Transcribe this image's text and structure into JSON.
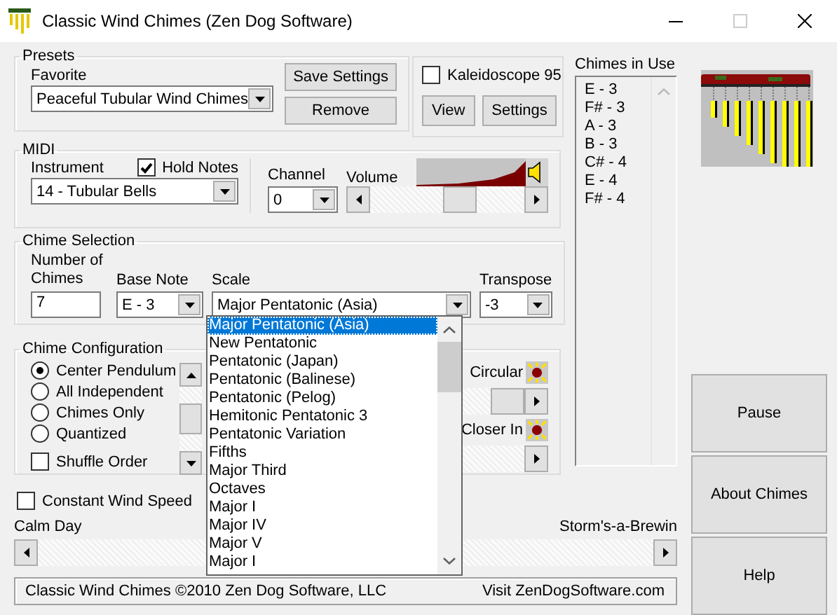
{
  "window": {
    "title": "Classic Wind Chimes (Zen Dog Software)"
  },
  "presets": {
    "title": "Presets",
    "favorite_label": "Favorite",
    "favorite": "Peaceful Tubular Wind Chimes",
    "buttons": [
      "Save Settings",
      "Remove"
    ]
  },
  "kaleidoscope": {
    "label": "Kaleidoscope 95",
    "checked": false,
    "buttons": [
      "View",
      "Settings"
    ]
  },
  "midi": {
    "title": "MIDI",
    "instrument_label": "Instrument",
    "instrument": "14 - Tubular Bells",
    "hold_notes": {
      "label": "Hold Notes",
      "checked": true
    },
    "channel_label": "Channel",
    "channel": "0",
    "volume_label": "Volume",
    "volume": {
      "level": 0.6
    }
  },
  "chime_selection": {
    "title": "Chime Selection",
    "number_label": "Number of Chimes",
    "number": "7",
    "base_note_label": "Base Note",
    "base_note": "E - 3",
    "scale_label": "Scale",
    "scale": "Major Pentatonic (Asia)",
    "transpose_label": "Transpose",
    "transpose": "-3"
  },
  "scale_dropdown": {
    "options": [
      {
        "label": "Major Pentatonic (Asia)",
        "selected": true
      },
      {
        "label": "New Pentatonic",
        "selected": false
      },
      {
        "label": "Pentatonic (Japan)",
        "selected": false
      },
      {
        "label": "Pentatonic (Balinese)",
        "selected": false
      },
      {
        "label": "Pentatonic (Pelog)",
        "selected": false
      },
      {
        "label": "Hemitonic Pentatonic 3",
        "selected": false
      },
      {
        "label": "Pentatonic Variation",
        "selected": false
      },
      {
        "label": "Fifths",
        "selected": false
      },
      {
        "label": "Major Third",
        "selected": false
      },
      {
        "label": "Octaves",
        "selected": false
      },
      {
        "label": "Major I",
        "selected": false
      },
      {
        "label": "Major IV",
        "selected": false
      },
      {
        "label": "Major V",
        "selected": false
      },
      {
        "label": "Major I",
        "selected": false
      }
    ]
  },
  "chime_configuration": {
    "title": "Chime Configuration",
    "modes": [
      {
        "label": "Center Pendulum",
        "selected": true
      },
      {
        "label": "All Independent",
        "selected": false
      },
      {
        "label": "Chimes Only",
        "selected": false
      },
      {
        "label": "Quantized",
        "selected": false
      }
    ],
    "shuffle_order": {
      "label": "Shuffle Order",
      "checked": false
    },
    "circular_label": "Circular",
    "closer_in_label": "Closer In"
  },
  "constant_wind_speed": {
    "label": "Constant Wind Speed",
    "checked": false
  },
  "wind": {
    "min_label": "Calm Day",
    "max_label": "Storm's-a-Brewin"
  },
  "chimes_in_use": {
    "title": "Chimes in Use",
    "items": [
      "E - 3",
      "F# - 3",
      "A - 3",
      "B - 3",
      "C# - 4",
      "E - 4",
      "F# - 4"
    ]
  },
  "actions": [
    "Pause",
    "About Chimes",
    "Help"
  ],
  "status_bar": {
    "left": "Classic Wind Chimes ©2010 Zen Dog Software, LLC",
    "right": "Visit ZenDogSoftware.com"
  }
}
